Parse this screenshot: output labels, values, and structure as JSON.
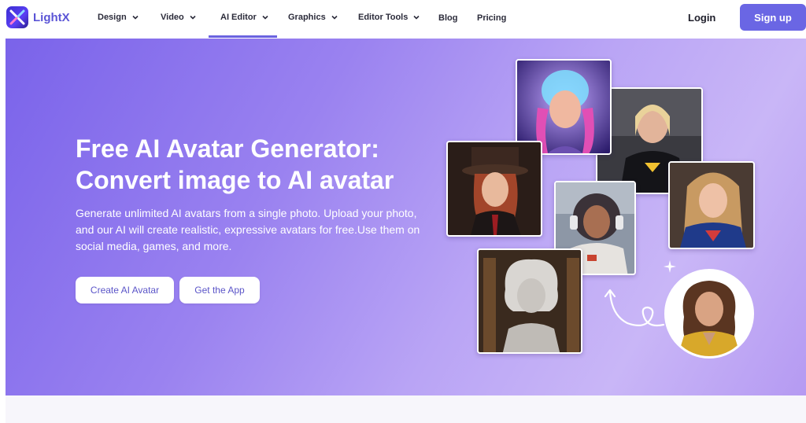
{
  "brand": {
    "name": "LightX"
  },
  "nav": {
    "items": [
      {
        "label": "Design",
        "has_dropdown": true
      },
      {
        "label": "Video",
        "has_dropdown": true
      },
      {
        "label": "AI Editor",
        "has_dropdown": true,
        "active": true
      },
      {
        "label": "Graphics",
        "has_dropdown": true
      },
      {
        "label": "Editor Tools",
        "has_dropdown": true
      },
      {
        "label": "Blog",
        "has_dropdown": false
      },
      {
        "label": "Pricing",
        "has_dropdown": false
      }
    ],
    "login_label": "Login",
    "signup_label": "Sign up"
  },
  "hero": {
    "title_line1": "Free AI Avatar Generator:",
    "title_line2": "Convert image to AI avatar",
    "subtitle": "Generate unlimited AI avatars from a single photo. Upload your photo, and our AI will create realistic, expressive avatars for free.Use them on social media, games, and more.",
    "primary_button": "Create AI Avatar",
    "secondary_button": "Get the App"
  },
  "gallery": {
    "images": [
      {
        "name": "cyber-avatar-image"
      },
      {
        "name": "superhero-avatar-image"
      },
      {
        "name": "steampunk-avatar-image"
      },
      {
        "name": "captain-avatar-image"
      },
      {
        "name": "astronaut-avatar-image"
      },
      {
        "name": "marble-statue-avatar-image"
      }
    ],
    "source_photo": {
      "name": "original-photo"
    }
  },
  "colors": {
    "accent": "#6a66e4",
    "hero_start": "#7a63ea",
    "hero_end": "#c9b6f7",
    "nav_text": "#2b2b3a"
  }
}
